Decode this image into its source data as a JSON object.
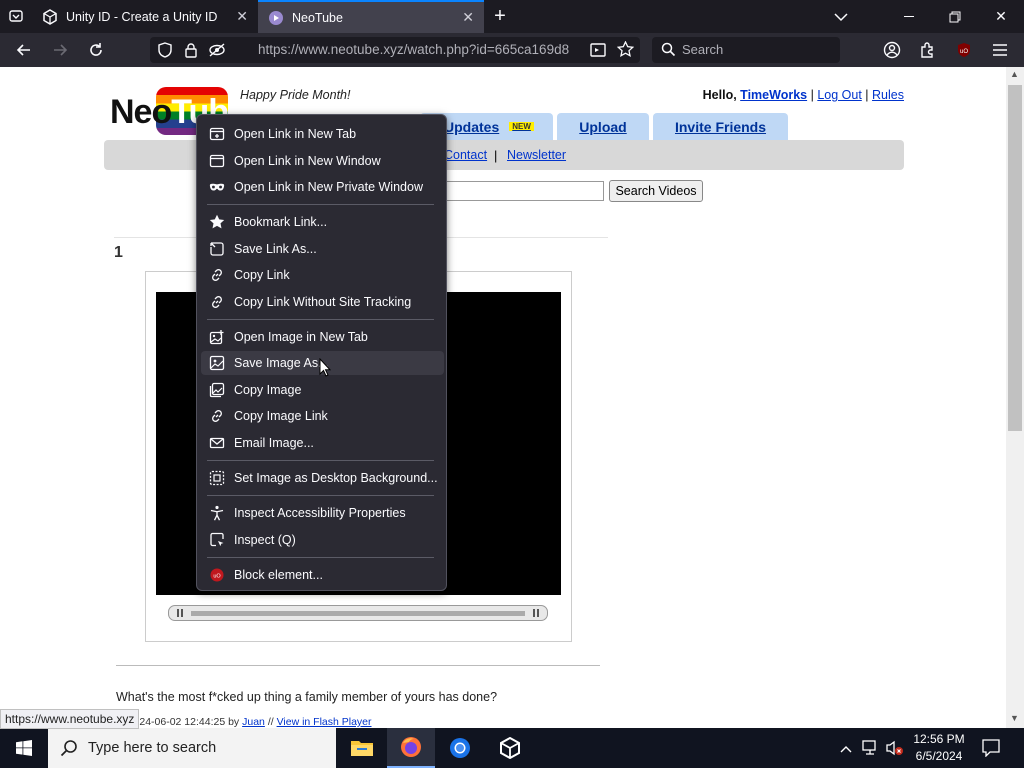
{
  "browser": {
    "tabs": [
      {
        "title": "Unity ID - Create a Unity ID",
        "icon": "unity-icon"
      },
      {
        "title": "NeoTube",
        "icon": "neotube-icon",
        "active": true
      }
    ],
    "url": "https://www.neotube.xyz/watch.php?id=665ca169d8",
    "search_placeholder": "Search",
    "status_url": "https://www.neotube.xyz"
  },
  "site": {
    "logo_neo": "Neo",
    "logo_tube": "Tube",
    "tagline": "Happy Pride Month!",
    "user": {
      "hello": "Hello,",
      "name": "TimeWorks",
      "logout": "Log Out",
      "rules": "Rules",
      "sep": "|"
    },
    "nav_tabs": [
      "Updates",
      "Upload",
      "Invite Friends"
    ],
    "new_badge": "NEW",
    "subnav": [
      "Contact",
      "Newsletter"
    ],
    "subnav_sep": "|",
    "search_button": "Search Videos",
    "video_number": "1",
    "video_title": "What's the most f*cked up thing a family member of yours has done?",
    "meta_prefix": "d: 2024-06-02 12:44:25 by",
    "meta_author": "Juan",
    "meta_sep": "//",
    "meta_flash": "View in Flash Player"
  },
  "context_menu": {
    "items": [
      {
        "label": "Open Link in New Tab",
        "icon": "new-tab-icon"
      },
      {
        "label": "Open Link in New Window",
        "icon": "new-window-icon"
      },
      {
        "label": "Open Link in New Private Window",
        "icon": "private-mask-icon"
      },
      {
        "label": "Bookmark Link...",
        "icon": "star-icon"
      },
      {
        "label": "Save Link As...",
        "icon": "save-page-icon"
      },
      {
        "label": "Copy Link",
        "icon": "link-icon"
      },
      {
        "label": "Copy Link Without Site Tracking",
        "icon": "link-icon"
      },
      {
        "label": "Open Image in New Tab",
        "icon": "image-new-tab-icon"
      },
      {
        "label": "Save Image As...",
        "icon": "image-icon"
      },
      {
        "label": "Copy Image",
        "icon": "image-copy-icon"
      },
      {
        "label": "Copy Image Link",
        "icon": "link-icon"
      },
      {
        "label": "Email Image...",
        "icon": "envelope-icon"
      },
      {
        "label": "Set Image as Desktop Background...",
        "icon": "desktop-background-icon"
      },
      {
        "label": "Inspect Accessibility Properties",
        "icon": "accessibility-icon"
      },
      {
        "label": "Inspect (Q)",
        "icon": "inspect-icon"
      },
      {
        "label": "Block element...",
        "icon": "ublock-icon"
      }
    ],
    "hovered": "Save Image As..."
  },
  "taskbar": {
    "search_placeholder": "Type here to search",
    "time": "12:56 PM",
    "date": "6/5/2024"
  },
  "colors": {
    "browser_dark": "#1c1b22",
    "toolbar": "#2b2a33",
    "link_blue": "#0033cc",
    "nav_tab_bg": "#bfd8f5",
    "accent": "#0a84ff"
  }
}
